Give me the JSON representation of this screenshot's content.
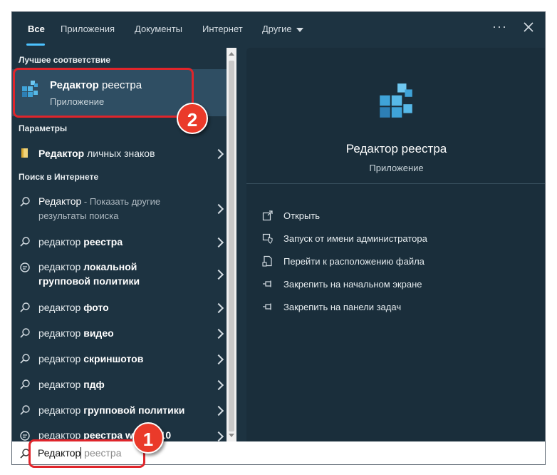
{
  "tabs": [
    "Все",
    "Приложения",
    "Документы",
    "Интернет",
    "Другие"
  ],
  "best_match": {
    "section": "Лучшее соответствие",
    "title_bold": "Редактор",
    "title_rest": " реестра",
    "subtitle": "Приложение"
  },
  "settings": {
    "section": "Параметры",
    "item_bold": "Редактор",
    "item_rest": " личных знаков"
  },
  "web": {
    "section": "Поиск в Интернете",
    "first": {
      "text": "Редактор",
      "suffix": " - Показать другие",
      "suffix2": "результаты поиска"
    },
    "items": [
      {
        "plain": "редактор ",
        "bold": "реестра"
      },
      {
        "plain": "редактор ",
        "bold": "локальной",
        "bold2": "групповой политики"
      },
      {
        "plain": "редактор ",
        "bold": "фото"
      },
      {
        "plain": "редактор ",
        "bold": "видео"
      },
      {
        "plain": "редактор ",
        "bold": "скриншотов"
      },
      {
        "plain": "редактор ",
        "bold": "пдф"
      },
      {
        "plain": "редактор ",
        "bold": "групповой политики"
      },
      {
        "plain": "редактор ",
        "bold": "реестра w",
        "tail": "s 10"
      }
    ]
  },
  "right": {
    "title": "Редактор реестра",
    "subtitle": "Приложение",
    "actions": [
      {
        "icon": "open-icon",
        "label": "Открыть"
      },
      {
        "icon": "admin-shield-icon",
        "label": "Запуск от имени администратора"
      },
      {
        "icon": "file-location-icon",
        "label": "Перейти к расположению файла"
      },
      {
        "icon": "pin-start-icon",
        "label": "Закрепить на начальном экране"
      },
      {
        "icon": "pin-taskbar-icon",
        "label": "Закрепить на панели задач"
      }
    ]
  },
  "search": {
    "typed": "Редактор",
    "hint": " реестра"
  },
  "badges": {
    "one": "1",
    "two": "2"
  },
  "colors": {
    "accent": "#4cc2ff",
    "highlight": "#e0252b",
    "badge": "#ea3a2a"
  }
}
